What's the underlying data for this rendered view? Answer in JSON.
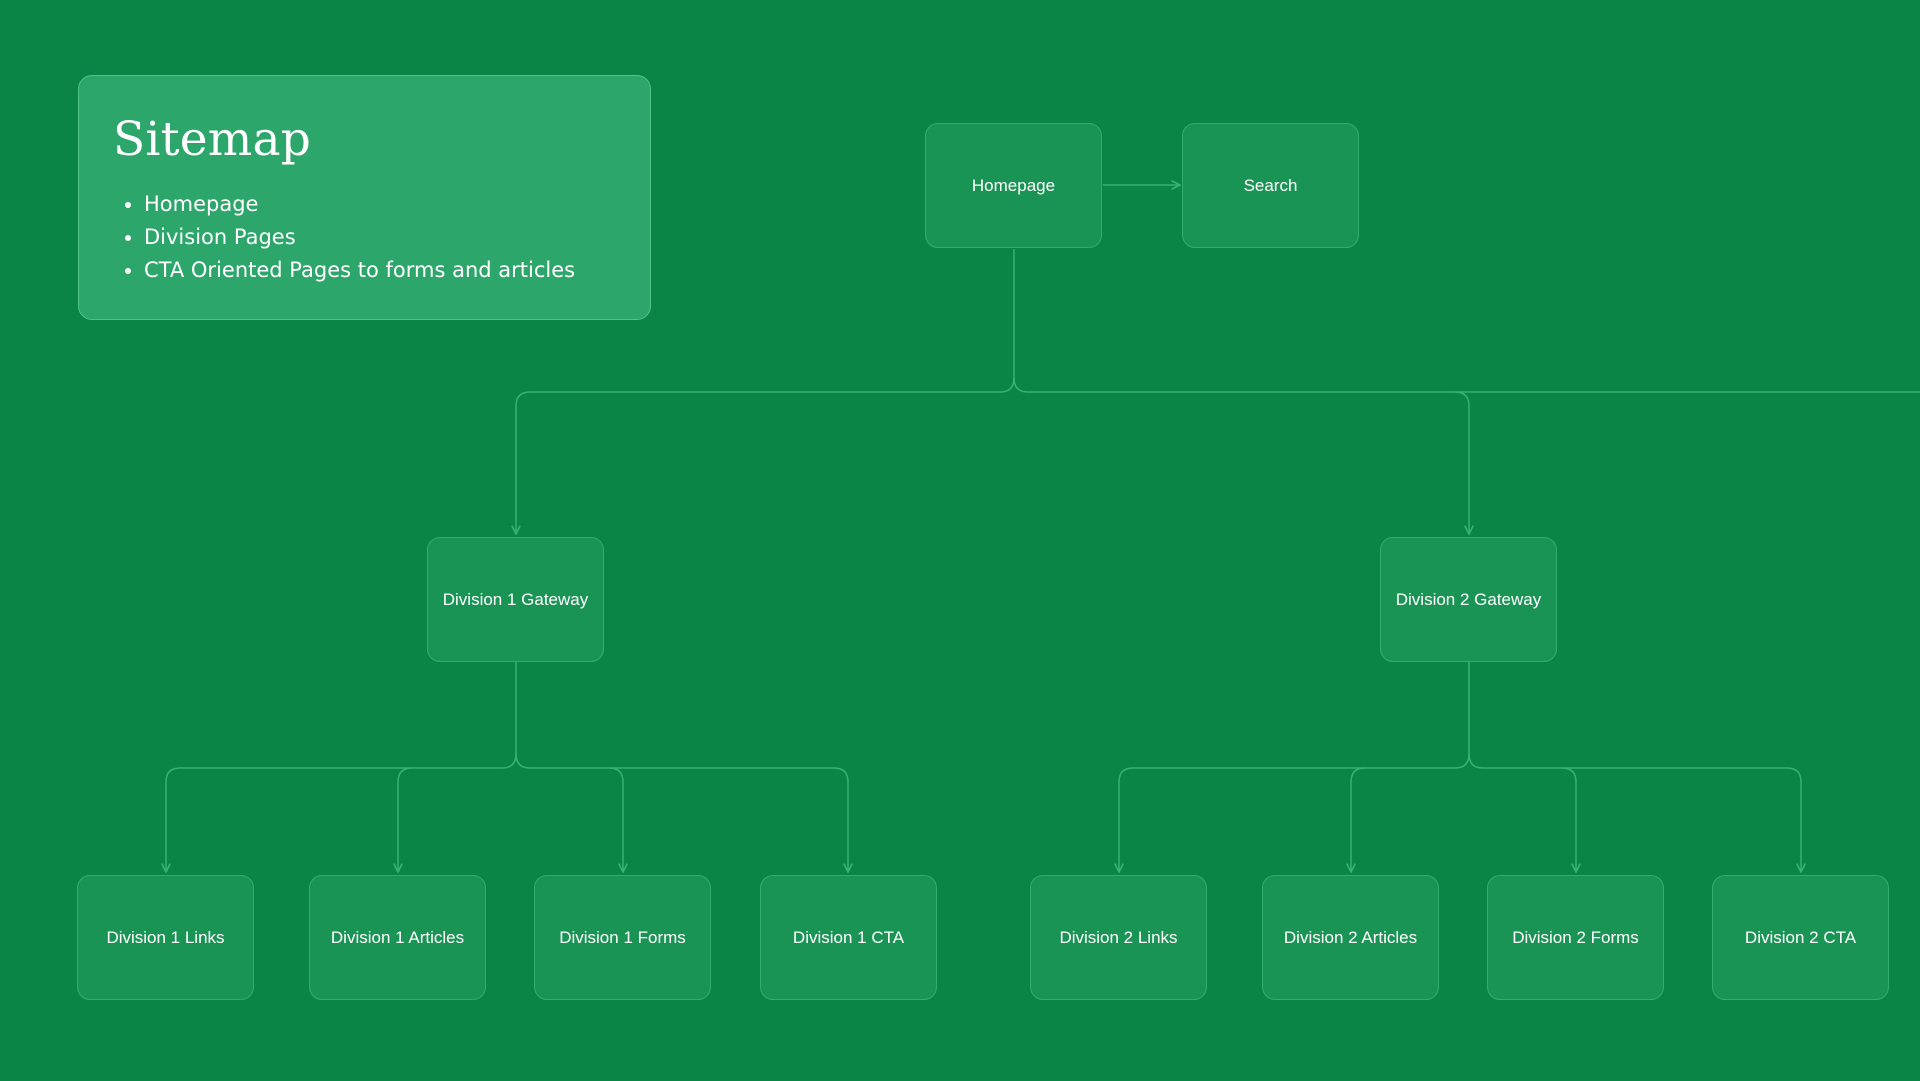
{
  "sitemap": {
    "title": "Sitemap",
    "items": [
      "Homepage",
      "Division Pages",
      "CTA Oriented Pages to forms and articles"
    ]
  },
  "nodes": {
    "homepage": "Homepage",
    "search": "Search",
    "div1_gateway": "Division 1 Gateway",
    "div2_gateway": "Division 2 Gateway",
    "div1_links": "Division 1 Links",
    "div1_articles": "Division 1 Articles",
    "div1_forms": "Division 1 Forms",
    "div1_cta": "Division 1 CTA",
    "div2_links": "Division 2 Links",
    "div2_articles": "Division 2 Articles",
    "div2_forms": "Division 2 Forms",
    "div2_cta": "Division 2 CTA"
  },
  "colors": {
    "background": "#0a8546",
    "card_fill": "#2ca66b",
    "node_fill": "#1a9454",
    "connector": "#37b271",
    "text": "#ffffff"
  }
}
